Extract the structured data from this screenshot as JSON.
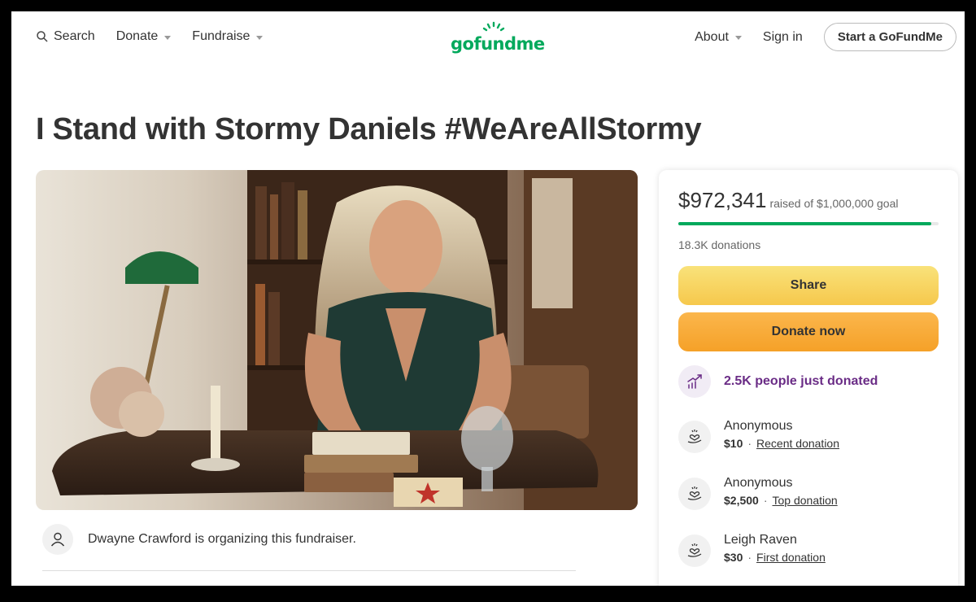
{
  "header": {
    "search_label": "Search",
    "donate_label": "Donate",
    "fundraise_label": "Fundraise",
    "logo_text": "gofundme",
    "about_label": "About",
    "signin_label": "Sign in",
    "start_label": "Start a GoFundMe"
  },
  "campaign": {
    "title": "I Stand with Stormy Daniels #WeAreAllStormy",
    "organizer_text": "Dwayne Crawford is organizing this fundraiser."
  },
  "sidebar": {
    "raised_amount": "$972,341",
    "raised_goal": "raised of $1,000,000 goal",
    "progress_fraction": 0.972,
    "donations_count": "18.3K donations",
    "share_label": "Share",
    "donate_now_label": "Donate now",
    "trend_text": "2.5K people just donated",
    "donations": [
      {
        "name": "Anonymous",
        "amount": "$10",
        "tag": "Recent donation"
      },
      {
        "name": "Anonymous",
        "amount": "$2,500",
        "tag": "Top donation"
      },
      {
        "name": "Leigh Raven",
        "amount": "$30",
        "tag": "First donation"
      }
    ]
  },
  "colors": {
    "brand_green": "#02a95c",
    "share_yellow": "#f6c84c",
    "donate_orange": "#f5a128",
    "trend_purple": "#6a2c86"
  }
}
